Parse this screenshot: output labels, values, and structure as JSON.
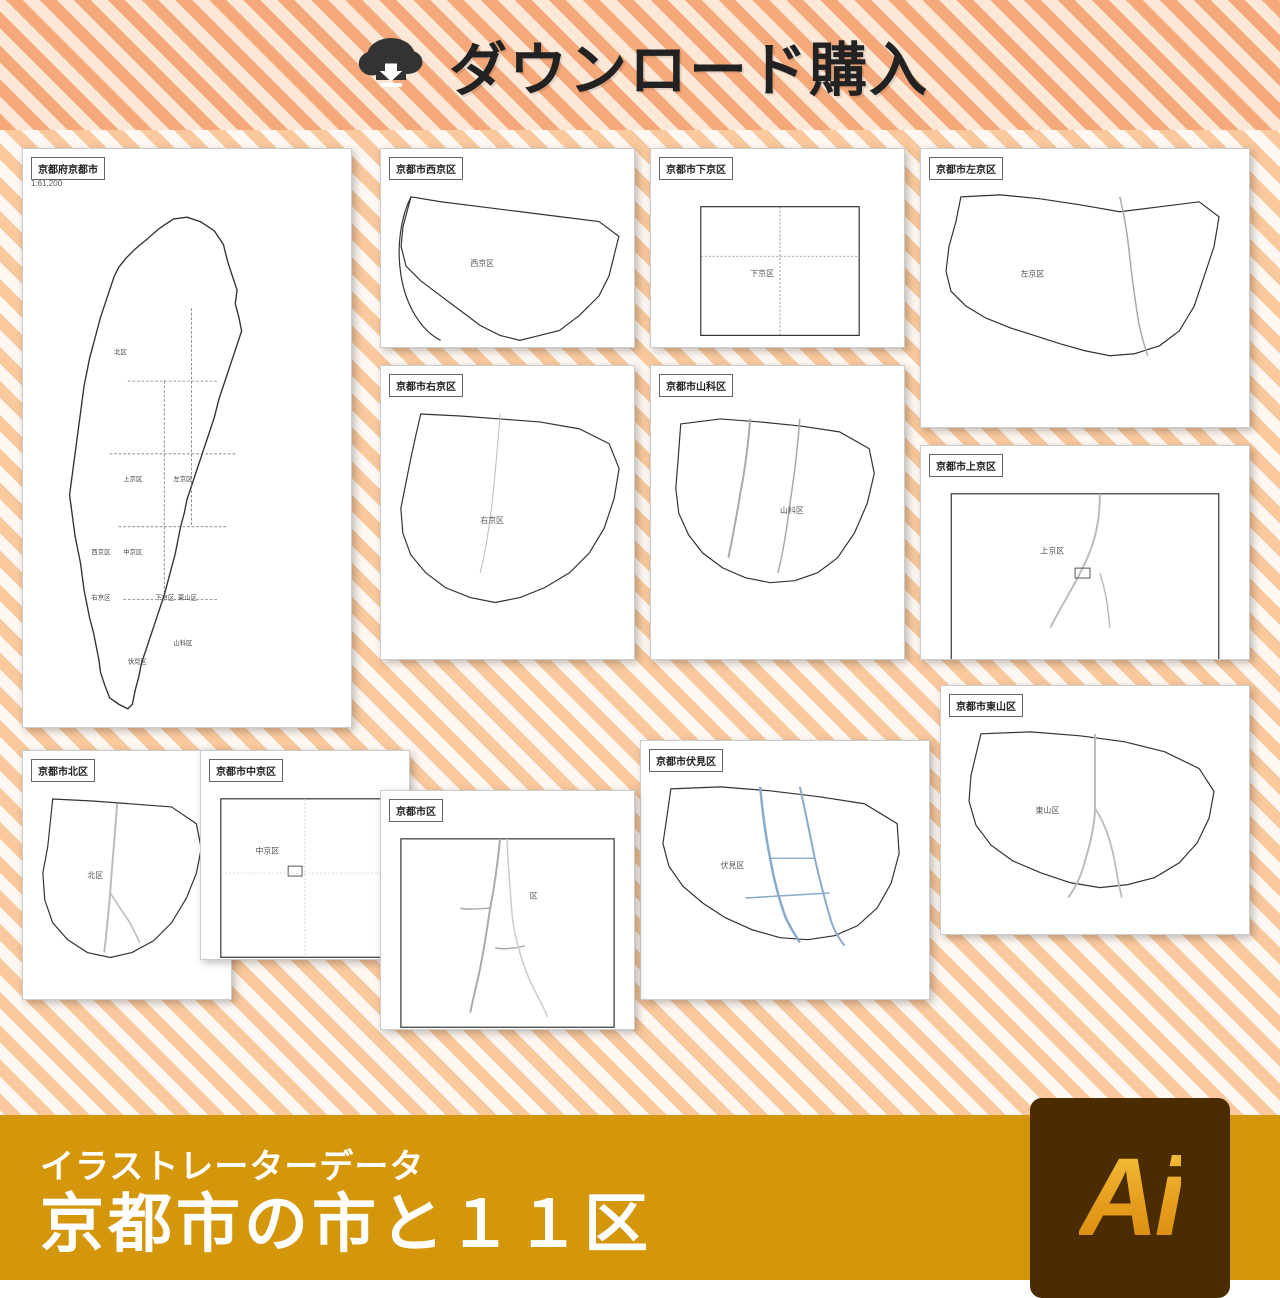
{
  "banner": {
    "title": "ダウンロード購入",
    "icon": "cloud-download"
  },
  "maps": {
    "main": {
      "title": "京都府京都市",
      "scale": "1:61,200"
    },
    "nishiku": {
      "title": "京都市西京区"
    },
    "shimogyo": {
      "title": "京都市下京区"
    },
    "sakyo": {
      "title": "京都市左京区"
    },
    "ukyo": {
      "title": "京都市右京区"
    },
    "yamashina": {
      "title": "京都市山科区"
    },
    "kamigyo": {
      "title": "京都市上京区"
    },
    "kitaku": {
      "title": "京都市北区"
    },
    "nakagyo": {
      "title": "京都市中京区"
    },
    "naka": {
      "title": "京都市区"
    },
    "fushimi": {
      "title": "京都市伏見区"
    },
    "higashiyama": {
      "title": "京都市東山区"
    }
  },
  "footer": {
    "subtitle": "イラストレーターデータ",
    "title": "京都市の市と１１区",
    "ai_label": "Ai"
  }
}
